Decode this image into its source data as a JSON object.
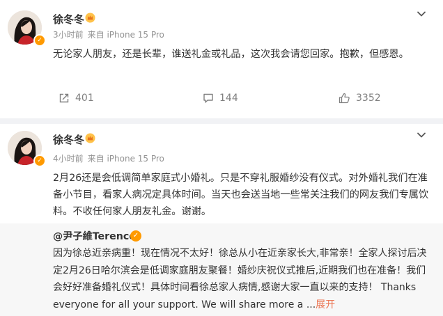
{
  "posts": [
    {
      "username": "徐冬冬",
      "time": "3小时前",
      "source": "来自 iPhone 15 Pro",
      "text": "无论家人朋友，还是长辈，谁送礼金或礼品，这次我会请您回家。抱歉，但感恩。",
      "actions": {
        "repost_count": "401",
        "comment_count": "144",
        "like_count": "3352"
      }
    },
    {
      "username": "徐冬冬",
      "time": "4小时前",
      "source": "来自 iPhone 15 Pro",
      "text": "2月26还是会低调简单家庭式小婚礼。只是不穿礼服婚纱没有仪式。对外婚礼我们在准备小节目，看家人病况定具体时间。当天也会送当地一些常关注我们的网友我们专属饮料。不收任何家人朋友礼金。谢谢。",
      "repost": {
        "username": "@尹子維Terence",
        "text": "因为徐总近亲病重！现在情况不太好！徐总从小在近亲家长大,非常亲！全家人探讨后决定2月26日哈尔滨会是低调家庭朋友聚餐！婚纱庆祝仪式推后,近期我们也在准备！我们会好好准备婚礼仪式！具体时间看徐总家人病情,感谢大家一直以来的支持！ Thanks everyone for all your support.  We will share more a",
        "ellipsis": "...",
        "expand_label": "展开"
      }
    }
  ],
  "colors": {
    "accent": "#eb7350",
    "verified": "#ff9a00",
    "meta": "#939393"
  },
  "icons": [
    "verified-badge-icon",
    "crown-icon",
    "chevron-down-icon",
    "repost-icon",
    "comment-icon",
    "like-icon"
  ]
}
